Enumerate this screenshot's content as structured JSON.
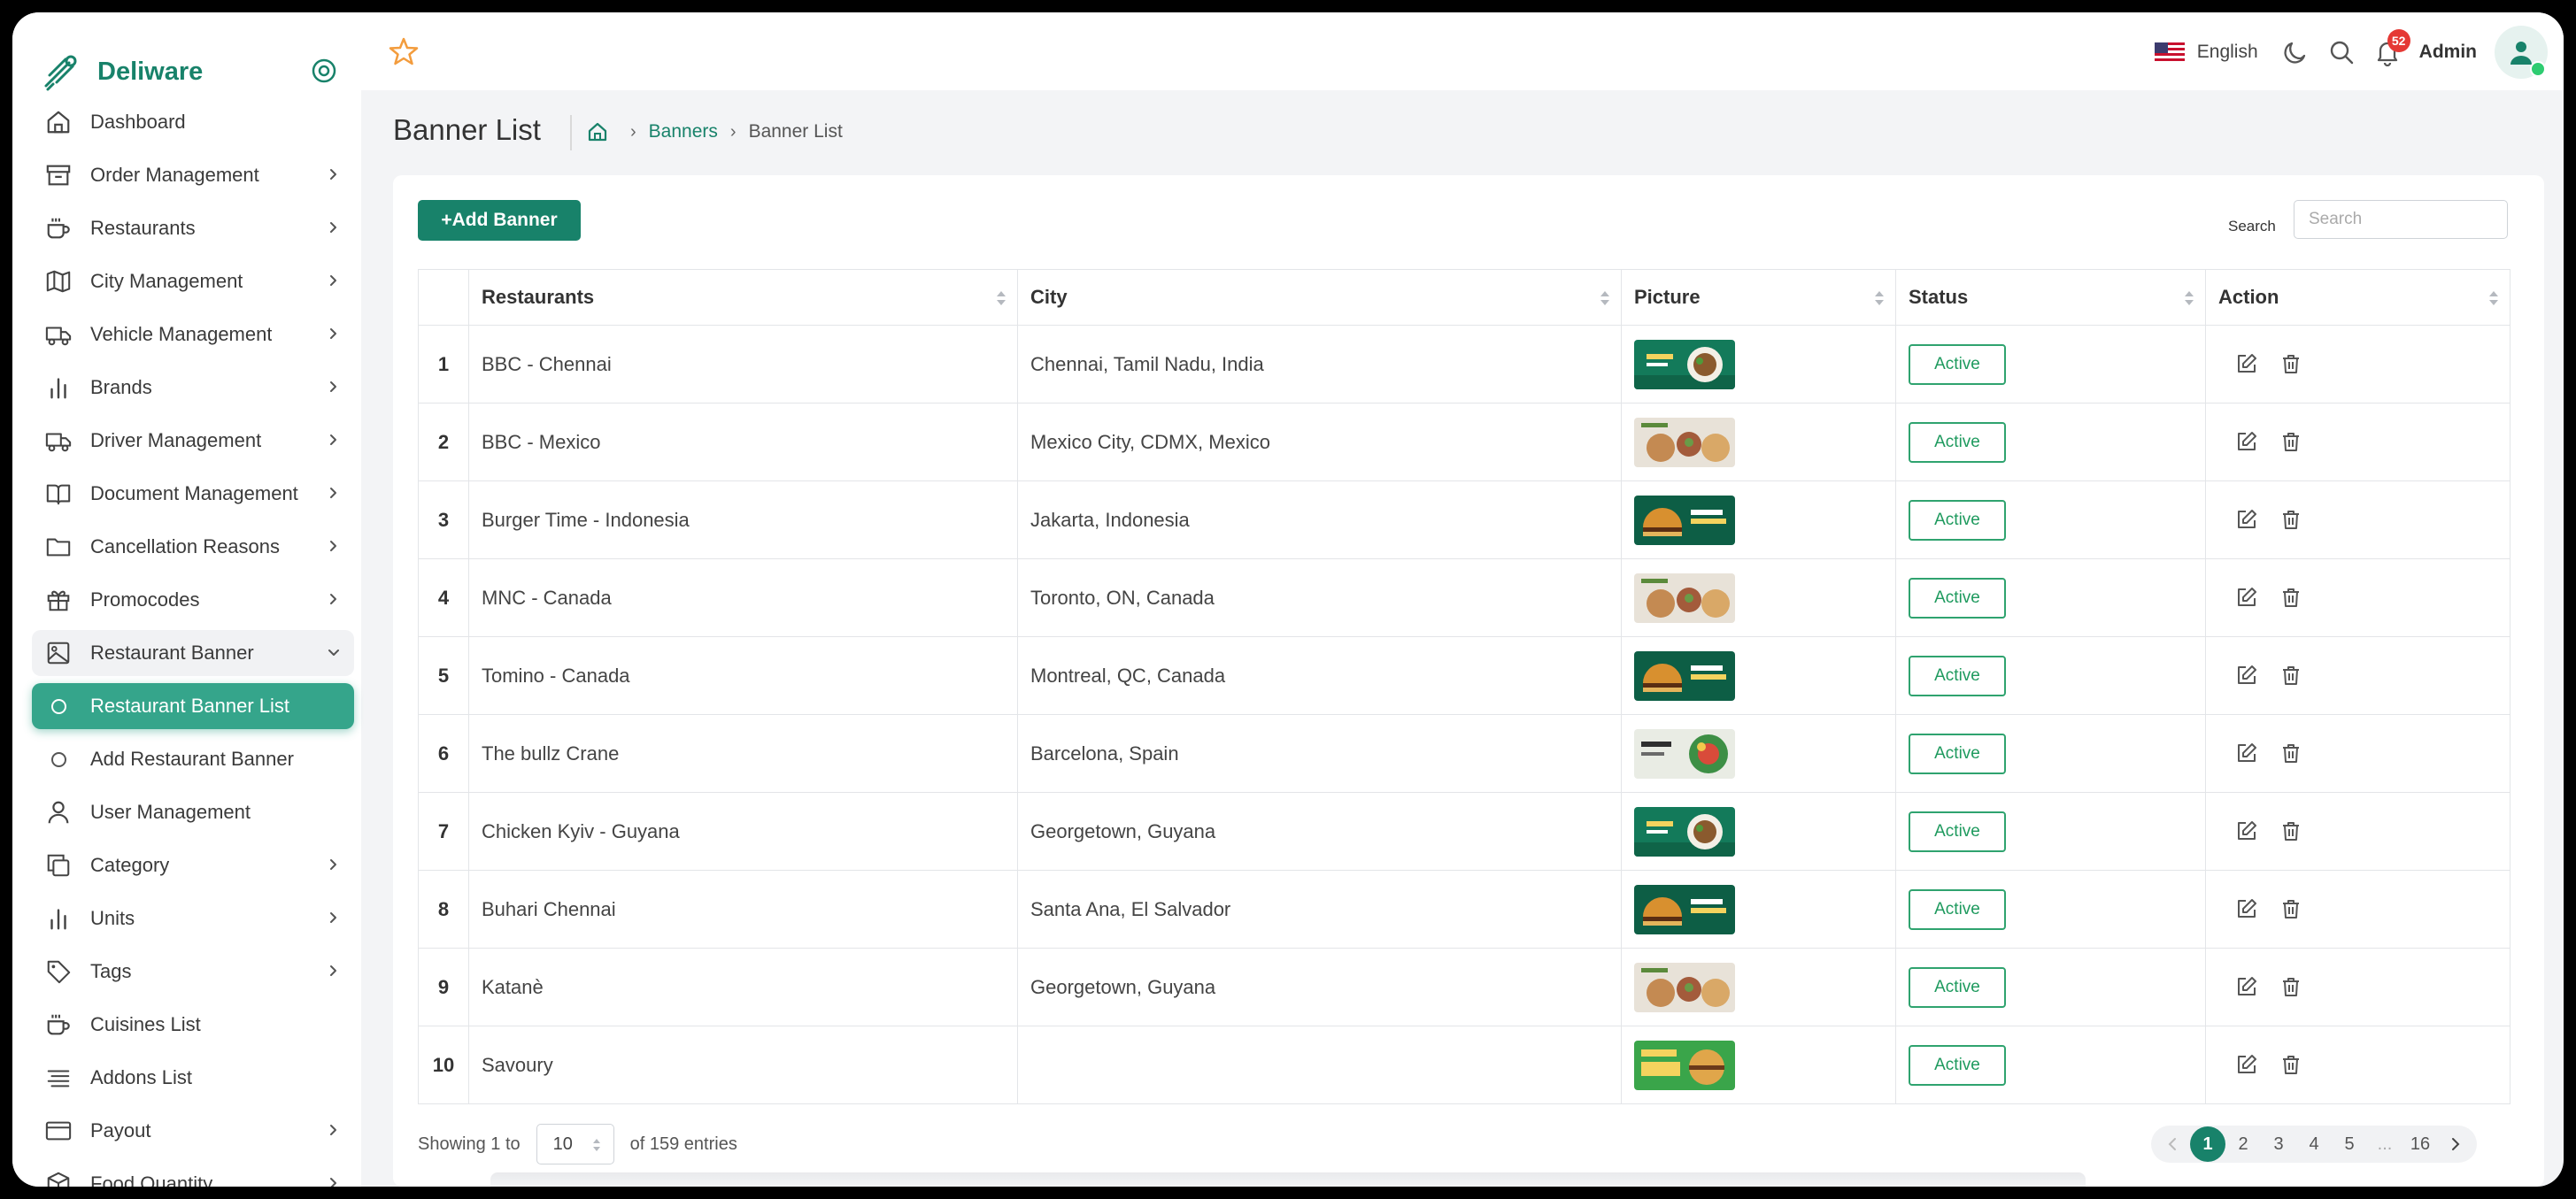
{
  "app": {
    "name": "Deliware",
    "brand_color": "#18826a"
  },
  "sidebar": {
    "items": [
      {
        "label": "Dashboard",
        "icon": "home-icon",
        "chevron": false
      },
      {
        "label": "Order Management",
        "icon": "archive-icon",
        "chevron": true
      },
      {
        "label": "Restaurants",
        "icon": "coffee-cup-icon",
        "chevron": true
      },
      {
        "label": "City Management",
        "icon": "map-icon",
        "chevron": true
      },
      {
        "label": "Vehicle Management",
        "icon": "truck-icon",
        "chevron": true
      },
      {
        "label": "Brands",
        "icon": "bar-chart-icon",
        "chevron": true
      },
      {
        "label": "Driver Management",
        "icon": "truck-icon",
        "chevron": true
      },
      {
        "label": "Document Management",
        "icon": "book-icon",
        "chevron": true
      },
      {
        "label": "Cancellation Reasons",
        "icon": "folder-icon",
        "chevron": true
      },
      {
        "label": "Promocodes",
        "icon": "gift-icon",
        "chevron": true
      },
      {
        "label": "Restaurant Banner",
        "icon": "image-icon",
        "chevron": true,
        "open": true
      },
      {
        "label": "Restaurant Banner List",
        "sub": true,
        "active": true
      },
      {
        "label": "Add Restaurant Banner",
        "sub": true
      },
      {
        "label": "User Management",
        "icon": "user-icon",
        "chevron": false
      },
      {
        "label": "Category",
        "icon": "copy-icon",
        "chevron": true
      },
      {
        "label": "Units",
        "icon": "bar-chart-icon",
        "chevron": true
      },
      {
        "label": "Tags",
        "icon": "tag-icon",
        "chevron": true
      },
      {
        "label": "Cuisines List",
        "icon": "coffee-cup-icon",
        "chevron": false
      },
      {
        "label": "Addons List",
        "icon": "list-icon",
        "chevron": false
      },
      {
        "label": "Payout",
        "icon": "credit-card-icon",
        "chevron": true
      },
      {
        "label": "Food Quantity",
        "icon": "box-icon",
        "chevron": true
      }
    ]
  },
  "topbar": {
    "language": "English",
    "notifications_count": "52",
    "user_name": "Admin"
  },
  "header": {
    "title": "Banner List",
    "breadcrumb": {
      "link": "Banners",
      "current": "Banner List"
    }
  },
  "toolbar": {
    "add_label": "+Add Banner",
    "search_label": "Search",
    "search_placeholder": "Search"
  },
  "table": {
    "columns": [
      "Restaurants",
      "City",
      "Picture",
      "Status",
      "Action"
    ],
    "rows": [
      {
        "num": "1",
        "restaurant": "BBC - Chennai",
        "city": "Chennai, Tamil Nadu, India",
        "thumb": "green-food",
        "status": "Active"
      },
      {
        "num": "2",
        "restaurant": "BBC - Mexico",
        "city": "Mexico City, CDMX, Mexico",
        "thumb": "light-food",
        "status": "Active"
      },
      {
        "num": "3",
        "restaurant": "Burger Time - Indonesia",
        "city": "Jakarta, Indonesia",
        "thumb": "dark-burger",
        "status": "Active"
      },
      {
        "num": "4",
        "restaurant": "MNC - Canada",
        "city": "Toronto, ON, Canada",
        "thumb": "light-food",
        "status": "Active"
      },
      {
        "num": "5",
        "restaurant": "Tomino - Canada",
        "city": "Montreal, QC, Canada",
        "thumb": "dark-burger",
        "status": "Active"
      },
      {
        "num": "6",
        "restaurant": "The bullz Crane",
        "city": "Barcelona, Spain",
        "thumb": "healthy",
        "status": "Active"
      },
      {
        "num": "7",
        "restaurant": "Chicken Kyiv - Guyana",
        "city": "Georgetown, Guyana",
        "thumb": "green-food",
        "status": "Active"
      },
      {
        "num": "8",
        "restaurant": "Buhari Chennai",
        "city": "Santa Ana, El Salvador",
        "thumb": "dark-burger",
        "status": "Active"
      },
      {
        "num": "9",
        "restaurant": "Katanè",
        "city": "Georgetown, Guyana",
        "thumb": "light-food",
        "status": "Active"
      },
      {
        "num": "10",
        "restaurant": "Savoury",
        "city": "",
        "thumb": "menu",
        "status": "Active"
      }
    ]
  },
  "footer": {
    "showing_prefix": "Showing 1 to",
    "page_size": "10",
    "showing_suffix": "of 159 entries",
    "pages": [
      "1",
      "2",
      "3",
      "4",
      "5",
      "...",
      "16"
    ],
    "current_page": "1"
  }
}
